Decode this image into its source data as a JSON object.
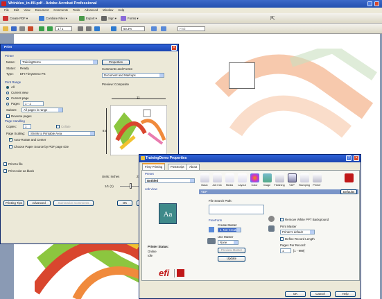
{
  "acrobat": {
    "title": "Wrinkles_in-fill.pdf - Adobe Acrobat Professional",
    "menu": [
      "File",
      "Edit",
      "View",
      "Document",
      "Comments",
      "Tools",
      "Advanced",
      "Window",
      "Help"
    ],
    "toolbar1": [
      "Create PDF",
      "Combine Files",
      "Export",
      "Sign",
      "Forms"
    ],
    "page_num": "1 / 1",
    "zoom": "50.3%",
    "find_placeholder": "Find"
  },
  "print": {
    "title": "Print",
    "printer_group": "Printer",
    "name_label": "Name:",
    "name_value": "TrainingDemo",
    "status_label": "Status:",
    "status_value": "Ready",
    "type_label": "Type:",
    "type_value": "EFI FieryDemo PS",
    "properties_btn": "Properties",
    "comments_forms_label": "Comments and Forms:",
    "comments_forms_value": "Document and Markups",
    "print_range_group": "Print Range",
    "range_all": "All",
    "range_current_view": "Current view",
    "range_current_page": "Current page",
    "range_pages": "Pages",
    "range_pages_value": "1 - 1",
    "subset_label": "Subset:",
    "subset_value": "All pages in range",
    "reverse_pages": "Reverse pages",
    "page_handling_group": "Page Handling",
    "copies_label": "Copies:",
    "copies_value": "1",
    "collate": "Collate",
    "page_scaling_label": "Page Scaling:",
    "page_scaling_value": "Shrink to Printable Area",
    "auto_rotate": "Auto-Rotate and Center",
    "choose_paper": "Choose Paper Source by PDF page size",
    "print_to_file": "Print to file",
    "print_color_black": "Print color as black",
    "preview_label": "Preview: Composite",
    "preview_width": "11",
    "preview_height": "8.5",
    "units_label": "Units: Inches",
    "zoom_label": "Zoom:",
    "page_indicator": "1/1 (1)",
    "printing_tips_btn": "Printing Tips",
    "advanced_btn": "Advanced",
    "summarize_btn": "Summarize Comments",
    "ok_btn": "OK",
    "cancel_btn": "Cancel"
  },
  "props": {
    "title": "TrainingDemo Properties",
    "tabs": [
      "Fiery Printing",
      "PostScript",
      "About"
    ],
    "preset_label": "Preset",
    "preset_value": "Untitled",
    "job_view_label": "Job View",
    "aa_text": "Aa",
    "printer_status_label": "Printer Status:",
    "printer_status_1": "Online",
    "printer_status_2": "Idle",
    "efi_logo": "efi",
    "icons": [
      "Basic",
      "Job Info",
      "Media",
      "Layout",
      "Color",
      "Image",
      "Finishing",
      "VDP",
      "Stamping",
      "Printer"
    ],
    "defaults_btn": "Defaults",
    "vdp_section": "VDP",
    "file_search_label": "File Search Path:",
    "freeform_label": "FreeForm",
    "create_master_label": "Create Master",
    "create_master_value": "1. Not Created",
    "use_master_label": "Use Master",
    "use_master_value": "None",
    "preview_master_btn": "Preview Master",
    "update_btn": "Update",
    "remove_white_bg": "Remove White PPT Background",
    "print_master_label": "Print Master",
    "print_master_value": "Printer's default",
    "define_record_length": "Define Record Length",
    "pages_per_record_label": "Pages Per Record:",
    "pages_per_record_value": "1",
    "pages_range_hint": "[1 - 999]",
    "ok_btn": "OK",
    "cancel_btn": "Cancel",
    "help_btn": "Help"
  },
  "colors": {
    "titlebar": "#2350b0",
    "dialog_bg": "#ece9d8",
    "ribbon_red": "#d9462e",
    "ribbon_orange": "#f08a3c"
  }
}
